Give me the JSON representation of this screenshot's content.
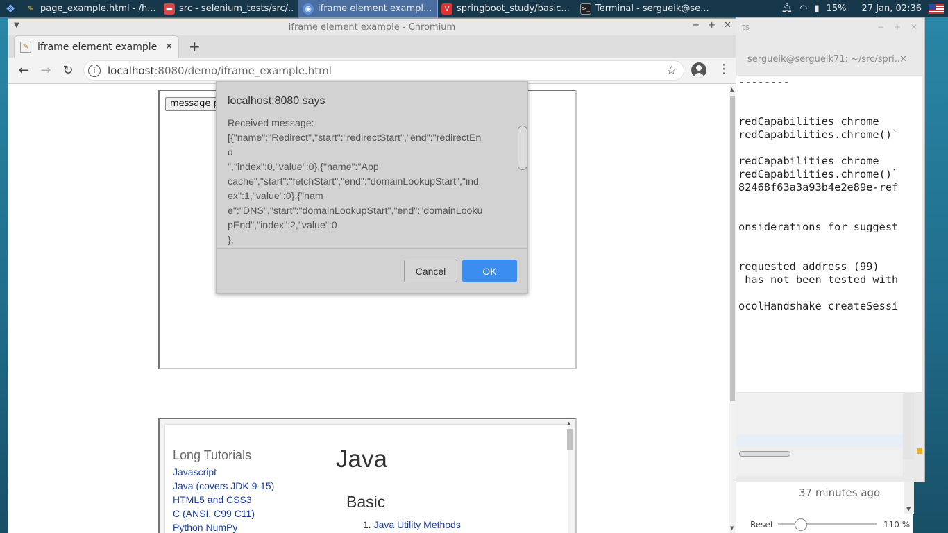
{
  "taskbar": {
    "tasks": [
      {
        "label": "page_example.html - /h...",
        "icon": "mousepad-icon"
      },
      {
        "label": "src - selenium_tests/src/...",
        "icon": "file-manager-icon"
      },
      {
        "label": "iframe element exampl...",
        "icon": "chromium-icon"
      },
      {
        "label": "springboot_study/basic...",
        "icon": "vivaldi-icon"
      },
      {
        "label": "Terminal - sergueik@se...",
        "icon": "terminal-icon"
      }
    ],
    "battery": "15%",
    "clock": "27 Jan, 02:36"
  },
  "terminal": {
    "tab_label": "sergueik@sergueik71: ~/src/spri...",
    "title_suffix": "ts",
    "lines": [
      "--------",
      "",
      "",
      "redCapabilities chrome",
      "redCapabilities.chrome()`",
      "",
      "redCapabilities chrome",
      "redCapabilities.chrome()`",
      "82468f63a3a93b4e2e89e-ref",
      "",
      "",
      "onsiderations for suggest",
      "",
      "",
      "requested address (99)",
      " has not been tested with",
      "",
      "ocolHandshake createSessi"
    ]
  },
  "ide": {
    "time_ago": "37 minutes ago",
    "reset_label": "Reset",
    "zoom_level": "110 %"
  },
  "browser": {
    "window_title": "iframe element example - Chromium",
    "tab_title": "iframe element example",
    "url_host": "localhost",
    "url_path": ":8080/demo/iframe_example.html"
  },
  "page": {
    "message_button": "message pa",
    "sidebar_heading": "Long Tutorials",
    "sidebar_links": [
      "Javascript",
      "Java (covers JDK 9-15)",
      "HTML5 and CSS3",
      "C (ANSI, C99 C11)",
      "Python NumPy"
    ],
    "heading": "Java",
    "subheading": "Basic",
    "list_number": "1.",
    "list_item": "Java Utility Methods"
  },
  "dialog": {
    "title": "localhost:8080 says",
    "body_lines": [
      "Received message:",
      "[{\"name\":\"Redirect\",\"start\":\"redirectStart\",\"end\":\"redirectEn",
      "d",
      "\",\"index\":0,\"value\":0},{\"name\":\"App",
      "cache\",\"start\":\"fetchStart\",\"end\":\"domainLookupStart\",\"ind",
      "ex\":1,\"value\":0},{\"nam",
      "e\":\"DNS\",\"start\":\"domainLookupStart\",\"end\":\"domainLooku",
      "pEnd\",\"index\":2,\"value\":0",
      "},"
    ],
    "cancel_label": "Cancel",
    "ok_label": "OK"
  }
}
